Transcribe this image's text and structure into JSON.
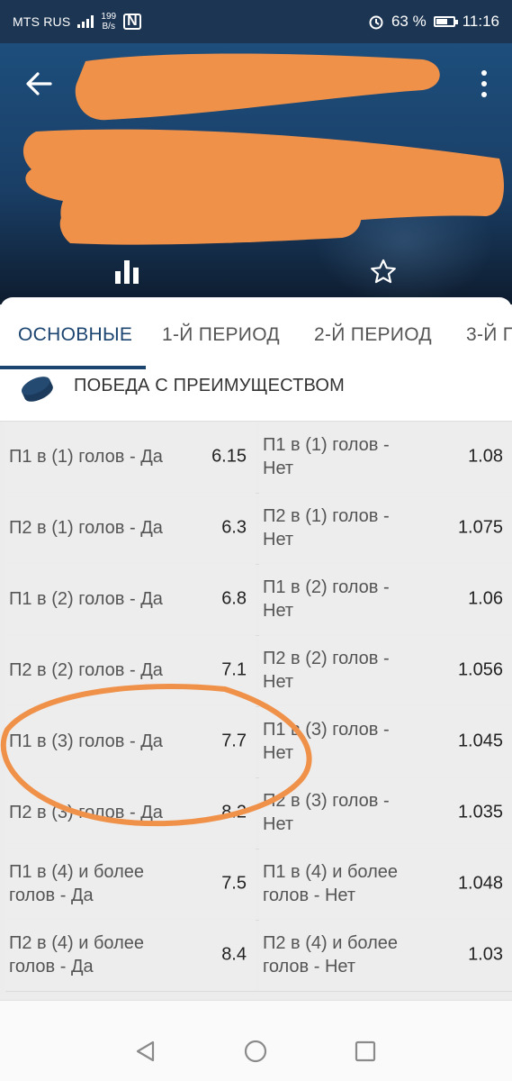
{
  "status_bar": {
    "carrier": "MTS RUS",
    "speed_value": "199",
    "speed_unit": "B/s",
    "nfc": "N",
    "battery": "63 %",
    "time": "11:16"
  },
  "header": {
    "back_icon": "arrow-left-icon",
    "menu_icon": "more-vertical-icon",
    "stats_icon": "bar-chart-icon",
    "favorite_icon": "star-outline-icon"
  },
  "tabs": [
    {
      "label": "ОСНОВНЫЕ",
      "active": true
    },
    {
      "label": "1-Й ПЕРИОД",
      "active": false
    },
    {
      "label": "2-Й ПЕРИОД",
      "active": false
    },
    {
      "label": "3-Й П",
      "active": false
    }
  ],
  "section": {
    "icon": "hockey-puck-icon",
    "title": "ПОБЕДА С ПРЕИМУЩЕСТВОМ"
  },
  "markets": [
    {
      "left": {
        "name": "П1 в (1) голов - Да",
        "odd": "6.15"
      },
      "right": {
        "name": "П1 в (1) голов - Нет",
        "odd": "1.08"
      }
    },
    {
      "left": {
        "name": "П2 в (1) голов - Да",
        "odd": "6.3"
      },
      "right": {
        "name": "П2 в (1) голов - Нет",
        "odd": "1.075"
      }
    },
    {
      "left": {
        "name": "П1 в (2) голов - Да",
        "odd": "6.8"
      },
      "right": {
        "name": "П1 в (2) голов - Нет",
        "odd": "1.06"
      }
    },
    {
      "left": {
        "name": "П2 в (2) голов - Да",
        "odd": "7.1"
      },
      "right": {
        "name": "П2 в (2) голов - Нет",
        "odd": "1.056"
      }
    },
    {
      "left": {
        "name": "П1 в (3) голов - Да",
        "odd": "7.7"
      },
      "right": {
        "name": "П1 в (3) голов - Нет",
        "odd": "1.045"
      }
    },
    {
      "left": {
        "name": "П2 в (3) голов - Да",
        "odd": "8.2"
      },
      "right": {
        "name": "П2 в (3) голов - Нет",
        "odd": "1.035"
      }
    },
    {
      "left": {
        "name": "П1 в (4)  и более голов - Да",
        "odd": "7.5"
      },
      "right": {
        "name": "П1 в (4)  и более голов - Нет",
        "odd": "1.048"
      }
    },
    {
      "left": {
        "name": "П2 в (4) и более голов - Да",
        "odd": "8.4"
      },
      "right": {
        "name": "П2 в (4) и более голов - Нет",
        "odd": "1.03"
      }
    }
  ],
  "annotation_color": "#f0914a",
  "navbar": {
    "back": "triangle-back-icon",
    "home": "circle-home-icon",
    "recents": "square-recents-icon"
  }
}
